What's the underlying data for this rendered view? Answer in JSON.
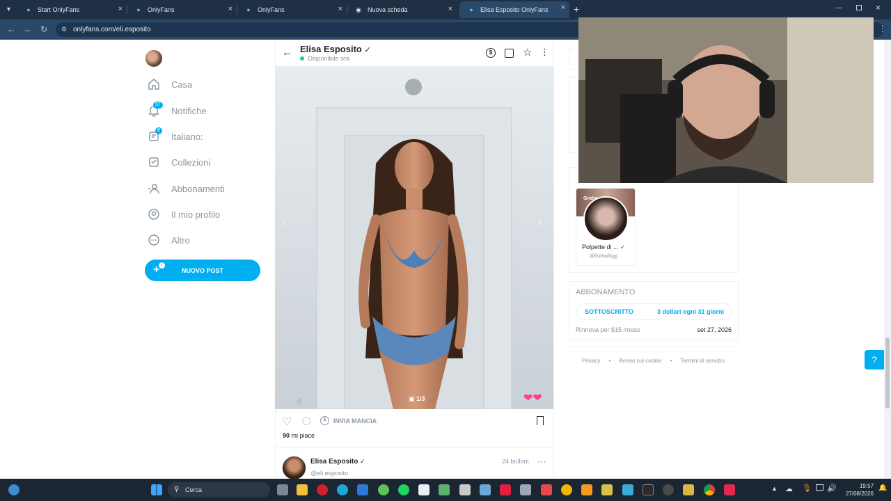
{
  "browser": {
    "tabs": [
      {
        "label": "Start OnlyFans",
        "active": false
      },
      {
        "label": "OnlyFans",
        "active": false
      },
      {
        "label": "OnlyFans",
        "active": false
      },
      {
        "label": "Nuova scheda",
        "active": false
      },
      {
        "label": "Elisa Esposito OnlyFans",
        "active": true
      }
    ],
    "new_tab": "+",
    "url": "onlyfans.com/eli.esposito"
  },
  "sidebar": {
    "items": [
      {
        "label": "Casa"
      },
      {
        "label": "Notifiche",
        "badge": "57"
      },
      {
        "label": "Italiano:",
        "badge": "8"
      },
      {
        "label": "Collezioni"
      },
      {
        "label": "Abbonamenti"
      },
      {
        "label": "Il mio profilo"
      },
      {
        "label": "Altro"
      }
    ],
    "new_post": "NUOVO POST",
    "new_post_badge": "!"
  },
  "post_header": {
    "name": "Elisa Esposito",
    "status": "Disponibile ora"
  },
  "post": {
    "counter": "1/3",
    "tip_label": "INVIA MANCIA",
    "likes": "90",
    "likes_suffix": "mi piace"
  },
  "next_post": {
    "name": "Elisa Esposito",
    "handle": "@eli.esposito",
    "meta": "24 bulloni"
  },
  "suggestion": {
    "free_label": "Gratis",
    "name": "Polpette di ...",
    "handle": "@fishballsgg"
  },
  "subscription": {
    "title": "ABBONAMENTO",
    "status": "SOTTOSCRITTO",
    "price": "3 dollari ogni 31 giorni",
    "renew": "Rinnova per $15 /mese",
    "renew_date": "set 27, 2026"
  },
  "footer_links": [
    "Privacy",
    "Avviso sui cookie",
    "Termini di servizio"
  ],
  "taskbar": {
    "search": "Cerca",
    "time": "19:57",
    "date": "27/08/2026"
  },
  "colors": {
    "accent": "#00aff0",
    "online": "#2ecc71"
  }
}
